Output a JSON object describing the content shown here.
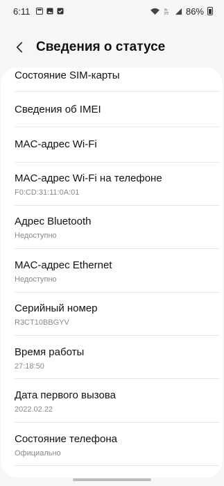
{
  "status_bar": {
    "time": "6:11",
    "battery": "86%"
  },
  "header": {
    "title": "Сведения о статусе"
  },
  "items": [
    {
      "title": "Состояние SIM-карты",
      "subtitle": ""
    },
    {
      "title": "Сведения об IMEI",
      "subtitle": ""
    },
    {
      "title": "MAC-адрес Wi-Fi",
      "subtitle": ""
    },
    {
      "title": "MAC-адрес Wi-Fi на телефоне",
      "subtitle": "F0:CD:31:11:0A:01"
    },
    {
      "title": "Адрес Bluetooth",
      "subtitle": "Недоступно"
    },
    {
      "title": "MAC-адрес Ethernet",
      "subtitle": "Недоступно"
    },
    {
      "title": "Серийный номер",
      "subtitle": "R3CT10BBGYV"
    },
    {
      "title": "Время работы",
      "subtitle": "27:18:50"
    },
    {
      "title": "Дата первого вызова",
      "subtitle": "2022.02.22"
    },
    {
      "title": "Состояние телефона",
      "subtitle": "Официально"
    }
  ]
}
